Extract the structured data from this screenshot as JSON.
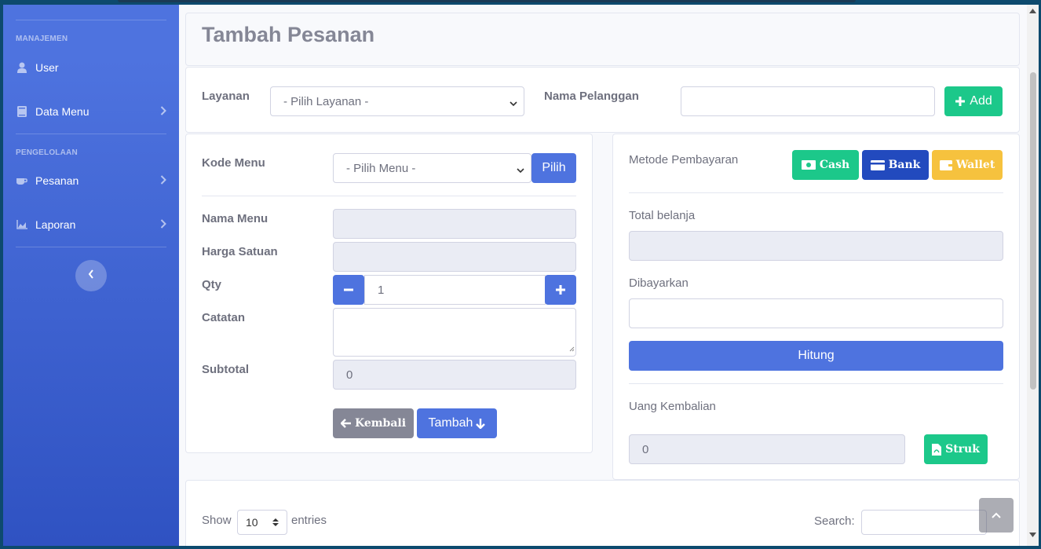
{
  "sidebar": {
    "heading_manajemen": "MANAJEMEN",
    "heading_pengelolaan": "PENGELOLAAN",
    "items": [
      {
        "label": "User",
        "icon": "user-icon"
      },
      {
        "label": "Data Menu",
        "icon": "book-icon"
      },
      {
        "label": "Pesanan",
        "icon": "coffee-icon"
      },
      {
        "label": "Laporan",
        "icon": "chart-area-icon"
      }
    ]
  },
  "header": {
    "title": "Tambah Pesanan"
  },
  "order": {
    "layanan_label": "Layanan",
    "layanan_selected": "- Pilih Layanan -",
    "pelanggan_label": "Nama Pelanggan",
    "pelanggan_value": "",
    "add_label": "Add"
  },
  "menu_form": {
    "kode_label": "Kode Menu",
    "kode_selected": "- Pilih Menu -",
    "pilih_label": "Pilih",
    "nama_label": "Nama Menu",
    "nama_value": "",
    "harga_label": "Harga Satuan",
    "harga_value": "",
    "qty_label": "Qty",
    "qty_value": "1",
    "catatan_label": "Catatan",
    "subtotal_label": "Subtotal",
    "subtotal_value": "0",
    "kembali_label": "Kembali",
    "tambah_label": "Tambah"
  },
  "payment": {
    "metode_label": "Metode Pembayaran",
    "cash_label": "Cash",
    "bank_label": "Bank",
    "wallet_label": "Wallet",
    "total_label": "Total belanja",
    "total_value": "",
    "dibayarkan_label": "Dibayarkan",
    "dibayarkan_value": "",
    "hitung_label": "Hitung",
    "kembalian_label": "Uang Kembalian",
    "kembalian_value": "0",
    "struk_label": "Struk"
  },
  "table": {
    "show_label": "Show",
    "entries_value": "10",
    "entries_label": "entries",
    "search_label": "Search:",
    "search_value": ""
  },
  "colors": {
    "primary": "#4e73df",
    "success": "#1cc88a",
    "warning": "#f6c23e",
    "secondary": "#858796"
  }
}
